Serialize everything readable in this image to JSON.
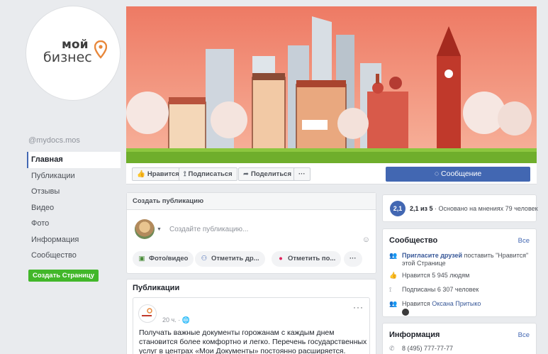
{
  "page": {
    "handle": "@mydocs.mos",
    "logo": {
      "line1": "мой",
      "line2": "бизнес"
    }
  },
  "nav": {
    "items": [
      {
        "label": "Главная"
      },
      {
        "label": "Публикации"
      },
      {
        "label": "Отзывы"
      },
      {
        "label": "Видео"
      },
      {
        "label": "Фото"
      },
      {
        "label": "Информация"
      },
      {
        "label": "Сообщество"
      }
    ],
    "create_page": "Создать Страницу"
  },
  "actions": {
    "like": "Нравится",
    "follow": "Подписаться",
    "share": "Поделиться",
    "more": "···",
    "message": "Сообщение"
  },
  "create_post": {
    "title": "Создать публикацию",
    "placeholder": "Создайте публикацию...",
    "buttons": [
      {
        "label": "Фото/видео",
        "icon": "photo-icon"
      },
      {
        "label": "Отметить др...",
        "icon": "tag-friends-icon"
      },
      {
        "label": "Отметить по...",
        "icon": "location-pin-icon"
      },
      {
        "label": "···",
        "icon": "more-icon"
      }
    ]
  },
  "posts": {
    "title": "Публикации",
    "post": {
      "time": "20 ч. · ",
      "more": "···",
      "text": "Получать важные документы горожанам с каждым днем становится более комфортно и легко. Перечень государственных услуг в центрах «Мои Документы» постоянно расширяется. Теперь у"
    }
  },
  "rating": {
    "badge": "2,1",
    "score": "2,1 из 5",
    "basis": " · Основано на мнениях 79 человек"
  },
  "community": {
    "title": "Сообщество",
    "all": "Все",
    "invite_link": "Пригласите друзей",
    "invite_rest": " поставить \"Нравится\" этой Странице",
    "likes": "Нравится 5 945 людям",
    "followers": "Подписаны 6 307 человек",
    "friend_prefix": "Нравится ",
    "friend_name": "Оксана Притыко"
  },
  "info": {
    "title": "Информация",
    "all": "Все",
    "phone": "8 (495) 777-77-77"
  },
  "colors": {
    "fb_blue": "#4267b2",
    "green": "#42b72a",
    "cover_sky": "#f0866f",
    "cover_ground": "#8cc63f"
  }
}
